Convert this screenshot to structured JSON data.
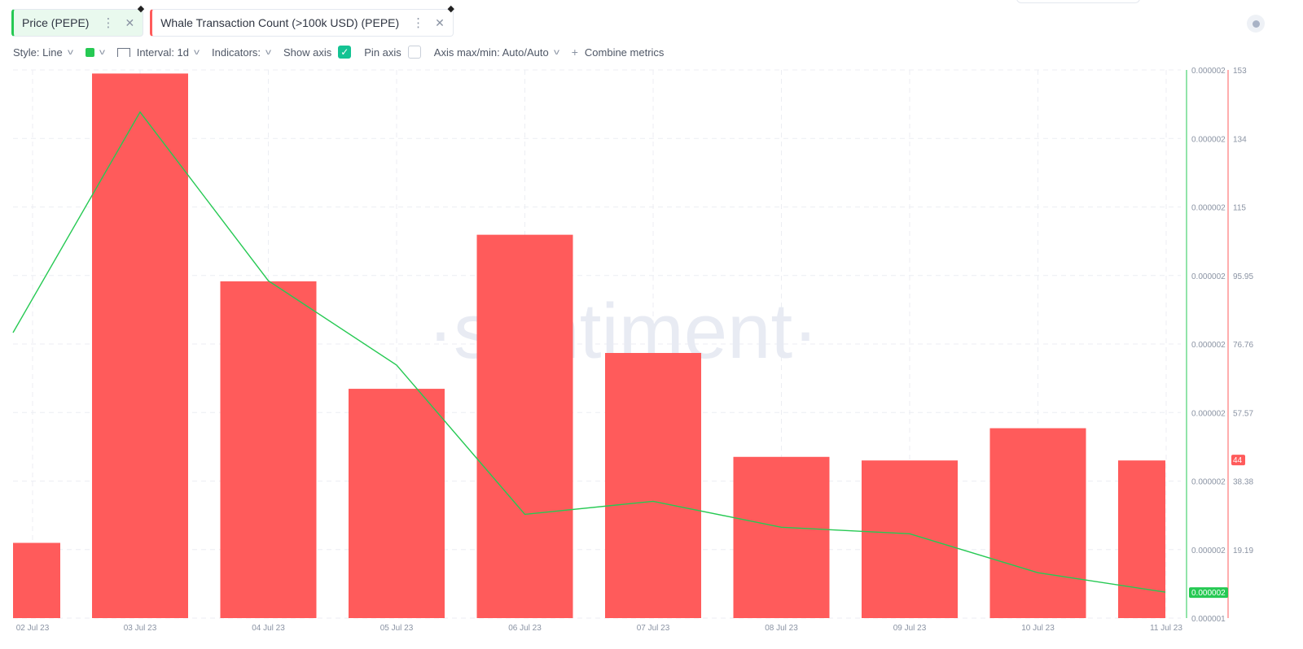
{
  "tabs": [
    {
      "label": "Price (PEPE)"
    },
    {
      "label": "Whale Transaction Count (>100k USD) (PEPE)"
    }
  ],
  "toolbar": {
    "style": "Style: Line",
    "interval": "Interval: 1d",
    "indicators": "Indicators:",
    "show_axis": "Show axis",
    "pin_axis": "Pin axis",
    "axis_maxmin": "Axis max/min: Auto/Auto",
    "combine": "Combine metrics"
  },
  "watermark": "·santiment·",
  "colors": {
    "price": "#26c953",
    "whale": "#ff5b5b"
  },
  "chart_data": {
    "type": "bar",
    "categories": [
      "02 Jul 23",
      "03 Jul 23",
      "04 Jul 23",
      "05 Jul 23",
      "06 Jul 23",
      "07 Jul 23",
      "08 Jul 23",
      "09 Jul 23",
      "10 Jul 23",
      "11 Jul 23"
    ],
    "x_tick_labels": [
      "02 Jul 23",
      "03 Jul 23",
      "04 Jul 23",
      "05 Jul 23",
      "06 Jul 23",
      "07 Jul 23",
      "08 Jul 23",
      "09 Jul 23",
      "10 Jul 23",
      "11 Jul 23"
    ],
    "series": [
      {
        "name": "Whale Transaction Count (>100k USD) (PEPE)",
        "type": "bar",
        "axis": "right",
        "values": [
          21,
          152,
          94,
          64,
          107,
          74,
          45,
          44,
          53,
          44
        ]
      },
      {
        "name": "Price (PEPE)",
        "type": "line",
        "axis": "left",
        "values": [
          1.8e-06,
          2.14e-06,
          1.88e-06,
          1.75e-06,
          1.52e-06,
          1.54e-06,
          1.5e-06,
          1.49e-06,
          1.43e-06,
          1.4e-06
        ]
      }
    ],
    "right_axis": {
      "ticks": [
        "153",
        "134",
        "115",
        "95.95",
        "76.76",
        "57.57",
        "38.38",
        "19.19",
        "0.000001"
      ],
      "ylim": [
        0,
        153
      ],
      "current_label": "44"
    },
    "left_axis": {
      "ticks": [
        "0.000002",
        "0.000002",
        "0.000002",
        "0.000002",
        "0.000002",
        "0.000002",
        "0.000002",
        "0.000002"
      ],
      "current_label": "0.000002"
    },
    "grid": true
  }
}
